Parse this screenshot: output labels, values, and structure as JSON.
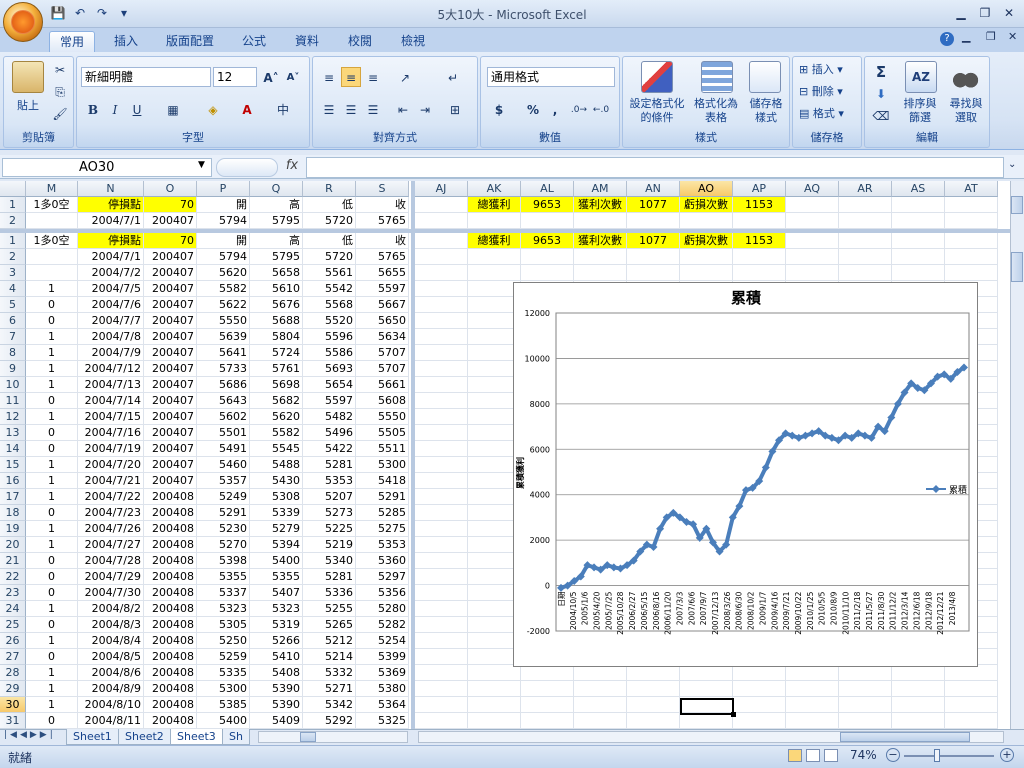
{
  "window": {
    "title": "5大10大 - Microsoft Excel"
  },
  "qat": {
    "save": "💾",
    "undo": "↶",
    "redo": "↷",
    "more": "▾"
  },
  "tabs": [
    "常用",
    "插入",
    "版面配置",
    "公式",
    "資料",
    "校閱",
    "檢視"
  ],
  "ribbon": {
    "clipboard": {
      "label": "剪貼簿",
      "paste": "貼上"
    },
    "font": {
      "label": "字型",
      "family": "新細明體",
      "size": "12",
      "bold": "B",
      "italic": "I",
      "underline": "U",
      "grow": "A˄",
      "shrink": "A˅"
    },
    "alignment": {
      "label": "對齊方式"
    },
    "number": {
      "label": "數值",
      "format": "通用格式",
      "currency": "$",
      "percent": "%",
      "comma": ","
    },
    "styles": {
      "label": "樣式",
      "conditional": "設定格式化\n的條件",
      "table": "格式化為\n表格",
      "cell": "儲存格\n樣式"
    },
    "cells": {
      "label": "儲存格",
      "insert": "插入",
      "delete": "刪除",
      "format": "格式"
    },
    "editing": {
      "label": "編輯",
      "sort": "排序與\n篩選",
      "find": "尋找與\n選取",
      "sum": "Σ"
    }
  },
  "formula_bar": {
    "name_box": "AO30",
    "fx": "fx",
    "formula": ""
  },
  "left_pane": {
    "columns": [
      "M",
      "N",
      "O",
      "P",
      "Q",
      "R",
      "S"
    ],
    "frozen_rows": [
      {
        "row": "1",
        "cells": [
          "1多0空",
          "停損點",
          "70",
          "開",
          "高",
          "低",
          "收"
        ]
      },
      {
        "row": "2",
        "cells": [
          "",
          "2004/7/1",
          "200407",
          "5794",
          "5795",
          "5720",
          "5765"
        ]
      }
    ],
    "rows": [
      {
        "row": "1",
        "cells": [
          "1多0空",
          "停損點",
          "70",
          "開",
          "高",
          "低",
          "收"
        ]
      },
      {
        "row": "2",
        "cells": [
          "",
          "2004/7/1",
          "200407",
          "5794",
          "5795",
          "5720",
          "5765"
        ]
      },
      {
        "row": "3",
        "cells": [
          "",
          "2004/7/2",
          "200407",
          "5620",
          "5658",
          "5561",
          "5655"
        ]
      },
      {
        "row": "4",
        "cells": [
          "1",
          "2004/7/5",
          "200407",
          "5582",
          "5610",
          "5542",
          "5597"
        ]
      },
      {
        "row": "5",
        "cells": [
          "0",
          "2004/7/6",
          "200407",
          "5622",
          "5676",
          "5568",
          "5667"
        ]
      },
      {
        "row": "6",
        "cells": [
          "0",
          "2004/7/7",
          "200407",
          "5550",
          "5688",
          "5520",
          "5650"
        ]
      },
      {
        "row": "7",
        "cells": [
          "1",
          "2004/7/8",
          "200407",
          "5639",
          "5804",
          "5596",
          "5634"
        ]
      },
      {
        "row": "8",
        "cells": [
          "1",
          "2004/7/9",
          "200407",
          "5641",
          "5724",
          "5586",
          "5707"
        ]
      },
      {
        "row": "9",
        "cells": [
          "1",
          "2004/7/12",
          "200407",
          "5733",
          "5761",
          "5693",
          "5707"
        ]
      },
      {
        "row": "10",
        "cells": [
          "1",
          "2004/7/13",
          "200407",
          "5686",
          "5698",
          "5654",
          "5661"
        ]
      },
      {
        "row": "11",
        "cells": [
          "0",
          "2004/7/14",
          "200407",
          "5643",
          "5682",
          "5597",
          "5608"
        ]
      },
      {
        "row": "12",
        "cells": [
          "1",
          "2004/7/15",
          "200407",
          "5602",
          "5620",
          "5482",
          "5550"
        ]
      },
      {
        "row": "13",
        "cells": [
          "0",
          "2004/7/16",
          "200407",
          "5501",
          "5582",
          "5496",
          "5505"
        ]
      },
      {
        "row": "14",
        "cells": [
          "0",
          "2004/7/19",
          "200407",
          "5491",
          "5545",
          "5422",
          "5511"
        ]
      },
      {
        "row": "15",
        "cells": [
          "1",
          "2004/7/20",
          "200407",
          "5460",
          "5488",
          "5281",
          "5300"
        ]
      },
      {
        "row": "16",
        "cells": [
          "1",
          "2004/7/21",
          "200407",
          "5357",
          "5430",
          "5353",
          "5418"
        ]
      },
      {
        "row": "17",
        "cells": [
          "1",
          "2004/7/22",
          "200408",
          "5249",
          "5308",
          "5207",
          "5291"
        ]
      },
      {
        "row": "18",
        "cells": [
          "0",
          "2004/7/23",
          "200408",
          "5291",
          "5339",
          "5273",
          "5285"
        ]
      },
      {
        "row": "19",
        "cells": [
          "1",
          "2004/7/26",
          "200408",
          "5230",
          "5279",
          "5225",
          "5275"
        ]
      },
      {
        "row": "20",
        "cells": [
          "1",
          "2004/7/27",
          "200408",
          "5270",
          "5394",
          "5219",
          "5353"
        ]
      },
      {
        "row": "21",
        "cells": [
          "0",
          "2004/7/28",
          "200408",
          "5398",
          "5400",
          "5340",
          "5360"
        ]
      },
      {
        "row": "22",
        "cells": [
          "0",
          "2004/7/29",
          "200408",
          "5355",
          "5355",
          "5281",
          "5297"
        ]
      },
      {
        "row": "23",
        "cells": [
          "0",
          "2004/7/30",
          "200408",
          "5337",
          "5407",
          "5336",
          "5356"
        ]
      },
      {
        "row": "24",
        "cells": [
          "1",
          "2004/8/2",
          "200408",
          "5323",
          "5323",
          "5255",
          "5280"
        ]
      },
      {
        "row": "25",
        "cells": [
          "0",
          "2004/8/3",
          "200408",
          "5305",
          "5319",
          "5265",
          "5282"
        ]
      },
      {
        "row": "26",
        "cells": [
          "1",
          "2004/8/4",
          "200408",
          "5250",
          "5266",
          "5212",
          "5254"
        ]
      },
      {
        "row": "27",
        "cells": [
          "0",
          "2004/8/5",
          "200408",
          "5259",
          "5410",
          "5214",
          "5399"
        ]
      },
      {
        "row": "28",
        "cells": [
          "1",
          "2004/8/6",
          "200408",
          "5335",
          "5408",
          "5332",
          "5369"
        ]
      },
      {
        "row": "29",
        "cells": [
          "1",
          "2004/8/9",
          "200408",
          "5300",
          "5390",
          "5271",
          "5380"
        ]
      },
      {
        "row": "30",
        "cells": [
          "1",
          "2004/8/10",
          "200408",
          "5385",
          "5390",
          "5342",
          "5364"
        ]
      },
      {
        "row": "31",
        "cells": [
          "0",
          "2004/8/11",
          "200408",
          "5400",
          "5409",
          "5292",
          "5325"
        ]
      }
    ]
  },
  "right_pane": {
    "columns": [
      "AJ",
      "AK",
      "AL",
      "AM",
      "AN",
      "AO",
      "AP",
      "AQ",
      "AR",
      "AS",
      "AT"
    ],
    "summary": [
      "",
      "總獲利",
      "9653",
      "獲利次數",
      "1077",
      "虧損次數",
      "1153",
      "",
      "",
      "",
      ""
    ]
  },
  "chart_data": {
    "type": "line",
    "title": "累積",
    "ylabel": "累積獲利",
    "ylim": [
      -2000,
      12000
    ],
    "yticks": [
      -2000,
      0,
      2000,
      4000,
      6000,
      8000,
      10000,
      12000
    ],
    "x_tick_labels": [
      "日期",
      "2004/10/5",
      "2005/1/6",
      "2005/4/20",
      "2005/7/25",
      "2005/10/28",
      "2006/2/27",
      "2006/5/15",
      "2006/8/16",
      "2006/11/20",
      "2007/3/3",
      "2007/6/6",
      "2007/9/7",
      "2007/12/13",
      "2008/3/26",
      "2008/6/30",
      "2008/10/2",
      "2009/1/7",
      "2009/4/16",
      "2009/7/21",
      "2009/10/22",
      "2010/1/25",
      "2010/5/5",
      "2010/8/9",
      "2010/11/10",
      "2011/2/18",
      "2011/5/27",
      "2011/8/30",
      "2011/12/2",
      "2012/3/14",
      "2012/6/18",
      "2012/9/18",
      "2012/12/21",
      "2013/4/8"
    ],
    "series": [
      {
        "name": "累積",
        "marker": "diamond",
        "color": "#4a7ebb",
        "values": [
          -100,
          0,
          200,
          400,
          900,
          800,
          700,
          900,
          800,
          750,
          900,
          1100,
          1500,
          1800,
          1700,
          2500,
          3000,
          3200,
          3000,
          2800,
          2700,
          2100,
          2500,
          1900,
          1500,
          1800,
          3000,
          3500,
          4200,
          4300,
          4600,
          5200,
          5900,
          6400,
          6700,
          6600,
          6500,
          6600,
          6700,
          6800,
          6600,
          6500,
          6400,
          6600,
          6500,
          6700,
          6600,
          6500,
          7000,
          6800,
          7400,
          8000,
          8500,
          8900,
          8700,
          8600,
          8900,
          9200,
          9300,
          9100,
          9400,
          9600
        ]
      }
    ],
    "legend": "right"
  },
  "sheets": [
    "Sheet1",
    "Sheet2",
    "Sheet3",
    "Sh"
  ],
  "status": {
    "ready": "就緒",
    "zoom": "74%"
  }
}
